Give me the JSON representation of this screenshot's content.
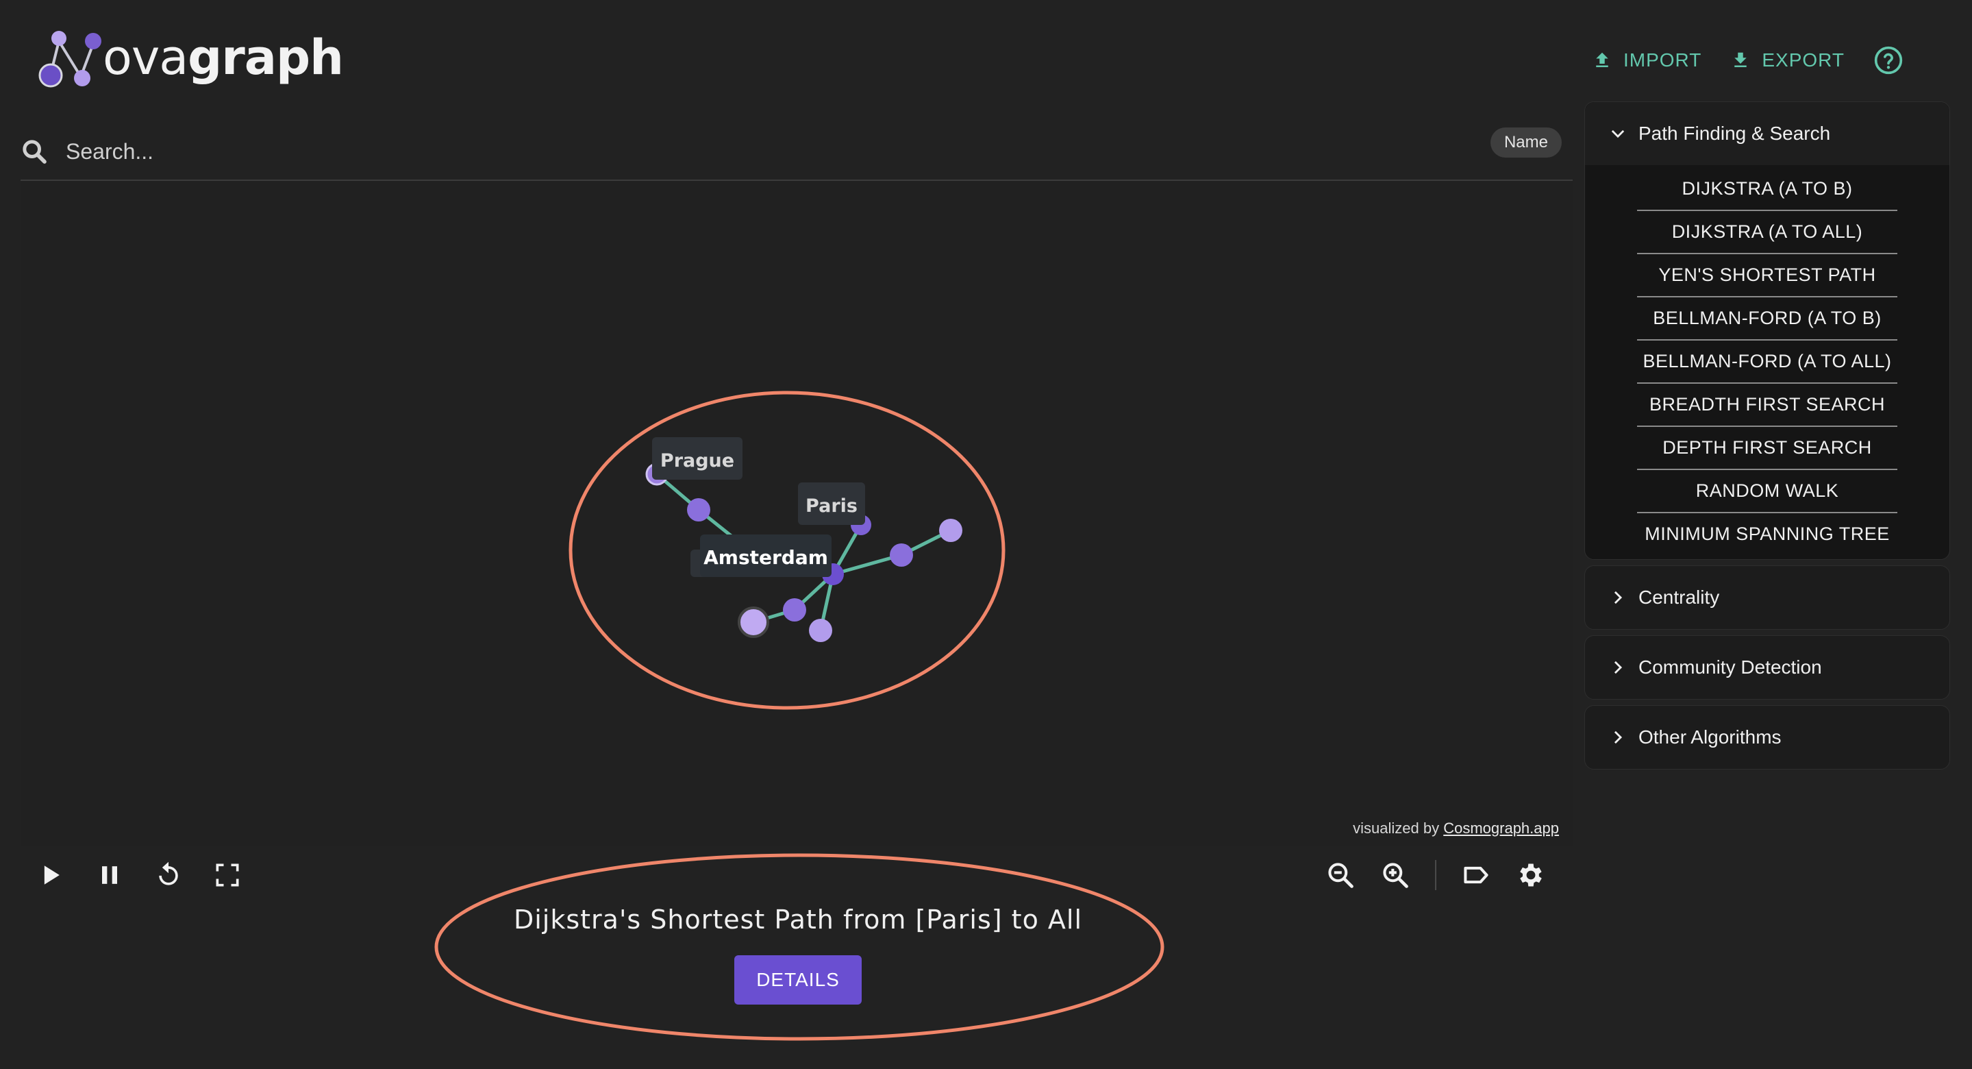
{
  "app": {
    "logo_text_regular": "ova",
    "logo_text_bold": "graph"
  },
  "toolbar": {
    "import_label": "IMPORT",
    "export_label": "EXPORT",
    "help_icon": "help-circle-icon",
    "accent": "#63c8ad"
  },
  "search": {
    "placeholder": "Search...",
    "value": "",
    "filter_chip": "Name"
  },
  "graph": {
    "node_color": "#9b7fe0",
    "edge_color": "#5fb8a0",
    "labels": [
      "Prague",
      "Paris",
      "Amsterdam"
    ],
    "credit_prefix": "visualized by ",
    "credit_link": "Cosmograph.app"
  },
  "controls": {
    "left": [
      "play-icon",
      "pause-icon",
      "restart-icon",
      "fullscreen-icon"
    ],
    "right": [
      "zoom-out-icon",
      "zoom-in-icon",
      "label-icon",
      "settings-icon"
    ]
  },
  "result": {
    "title": "Dijkstra's Shortest Path from [Paris] to All",
    "details_label": "DETAILS",
    "button_color": "#6a4fd1"
  },
  "annotation_color": "#f0866a",
  "sidebar": {
    "sections": [
      {
        "label": "Path Finding & Search",
        "expanded": true,
        "items": [
          "DIJKSTRA (A TO B)",
          "DIJKSTRA (A TO ALL)",
          "YEN'S SHORTEST PATH",
          "BELLMAN-FORD (A TO B)",
          "BELLMAN-FORD (A TO ALL)",
          "BREADTH FIRST SEARCH",
          "DEPTH FIRST SEARCH",
          "RANDOM WALK",
          "MINIMUM SPANNING TREE"
        ]
      },
      {
        "label": "Centrality",
        "expanded": false
      },
      {
        "label": "Community Detection",
        "expanded": false
      },
      {
        "label": "Other Algorithms",
        "expanded": false
      }
    ]
  }
}
